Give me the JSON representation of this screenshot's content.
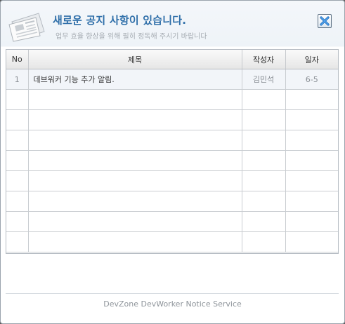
{
  "header": {
    "title": "새로운 공지 사항이 있습니다.",
    "subtitle": "업무 효율 향상을 위해 필히 정독해 주시기 바랍니다",
    "close_icon": "close-x-icon",
    "logo_icon": "newspaper-icon"
  },
  "table": {
    "columns": [
      "No",
      "제목",
      "작성자",
      "일자"
    ],
    "rows": [
      {
        "no": "1",
        "title": "데브워커 기능 추가 알림.",
        "author": "김민석",
        "date": "6-5"
      }
    ]
  },
  "footer": {
    "text": "DevZone DevWorker Notice Service"
  },
  "colors": {
    "title": "#2f6fa9",
    "close_x": "#2a84d8",
    "row_bg": "#f2f5f9"
  }
}
